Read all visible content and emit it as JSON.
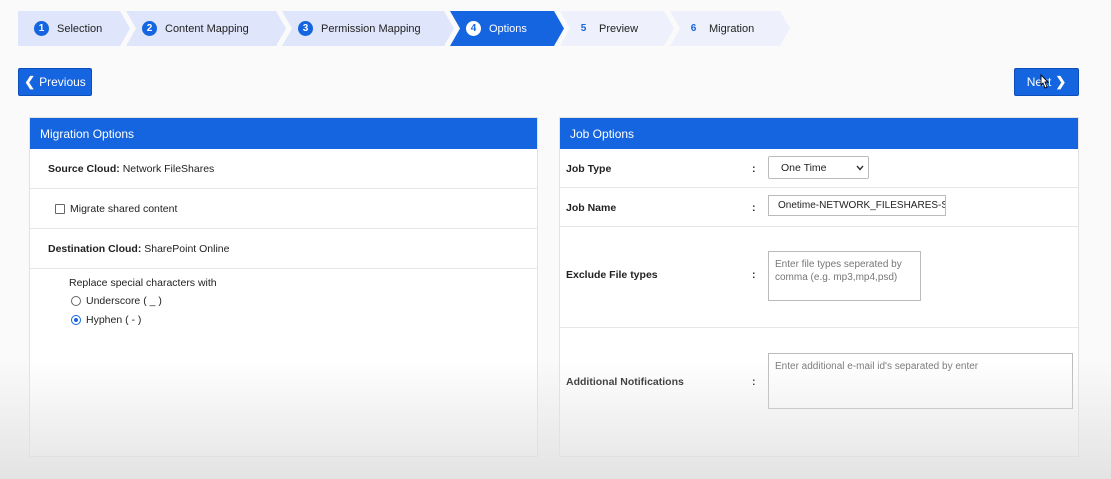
{
  "wizard": {
    "steps": [
      {
        "num": "1",
        "label": "Selection"
      },
      {
        "num": "2",
        "label": "Content Mapping"
      },
      {
        "num": "3",
        "label": "Permission Mapping"
      },
      {
        "num": "4",
        "label": "Options"
      },
      {
        "num": "5",
        "label": "Preview"
      },
      {
        "num": "6",
        "label": "Migration"
      }
    ],
    "active_step": "4"
  },
  "nav": {
    "previous_label": "Previous",
    "next_label": "Next"
  },
  "migration_options": {
    "title": "Migration Options",
    "source_cloud_label": "Source Cloud:",
    "source_cloud_value": "Network FileShares",
    "migrate_shared_label": "Migrate shared content",
    "destination_cloud_label": "Destination Cloud:",
    "destination_cloud_value": "SharePoint Online",
    "replace_label": "Replace special characters with",
    "replace_options": [
      {
        "label": "Underscore ( _ )",
        "checked": false
      },
      {
        "label": "Hyphen ( - )",
        "checked": true
      }
    ]
  },
  "job_options": {
    "title": "Job Options",
    "colon": ":",
    "job_type_label": "Job Type",
    "job_type_value": "One Time",
    "job_name_label": "Job Name",
    "job_name_value": "Onetime-NETWORK_FILESHARES-SI",
    "exclude_label": "Exclude File types",
    "exclude_placeholder": "Enter file types seperated by comma (e.g. mp3,mp4,psd)",
    "notifications_label": "Additional Notifications",
    "notifications_placeholder": "Enter additional e-mail id's separated by enter"
  },
  "colors": {
    "accent": "#1565e0",
    "step_inactive": "#dfe6fb"
  }
}
